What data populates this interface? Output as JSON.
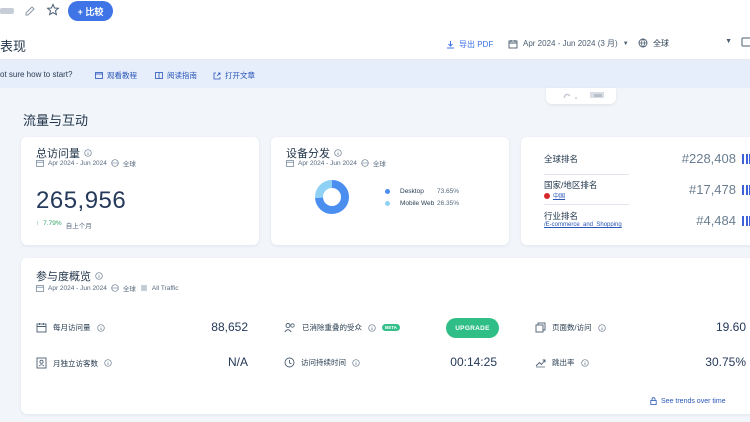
{
  "topbar": {
    "compare_label": "+ 比较"
  },
  "header": {
    "title": "表现",
    "export_label": "导出 PDF",
    "date_range": "Apr 2024 - Jun 2024 (3 月)",
    "region": "全球"
  },
  "helpbar": {
    "text": "ot sure how to start?",
    "links": [
      "观看教程",
      "阅读指南",
      "打开文章"
    ]
  },
  "section": {
    "title": "流量与互动"
  },
  "visits_card": {
    "title": "总访问量",
    "date": "Apr 2024 - Jun 2024",
    "region": "全球",
    "value": "265,956",
    "delta": "7.79%",
    "delta_label": "自上个月"
  },
  "device_card": {
    "title": "设备分发",
    "date": "Apr 2024 - Jun 2024",
    "region": "全球",
    "items": [
      {
        "label": "Desktop",
        "pct": "73.65%",
        "share": 0.7365,
        "color": "#4a8ef0"
      },
      {
        "label": "Mobile Web",
        "pct": "26.35%",
        "share": 0.2635,
        "color": "#8fd0f5"
      }
    ]
  },
  "rank_card": {
    "global": {
      "label": "全球排名",
      "value": "#228,408"
    },
    "country": {
      "label": "国家/地区排名",
      "sub": "中国",
      "value": "#17,478"
    },
    "industry": {
      "label": "行业排名",
      "sub": "/E-commerce_and_Shopping",
      "value": "#4,484"
    }
  },
  "engagement": {
    "title": "参与度概览",
    "date": "Apr 2024 - Jun 2024",
    "region": "全球",
    "traffic": "All Traffic",
    "monthly_visits": {
      "label": "每月访问量",
      "value": "88,652"
    },
    "monthly_unique": {
      "label": "月独立访客数",
      "value": "N/A"
    },
    "dedup_audience": {
      "label": "已消除重叠的受众",
      "badge": "BETA",
      "button": "UPGRADE"
    },
    "visit_duration": {
      "label": "访问持续时间",
      "value": "00:14:25"
    },
    "pages_per_visit": {
      "label": "页面数/访问",
      "value": "19.60"
    },
    "bounce_rate": {
      "label": "跳出率",
      "value": "30.75%"
    },
    "trends_link": "See trends over time"
  }
}
